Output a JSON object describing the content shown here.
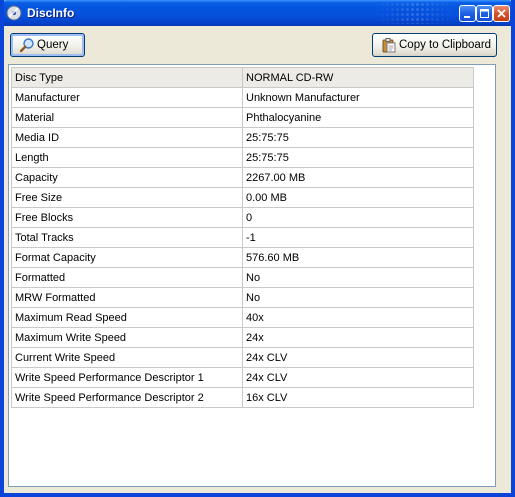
{
  "window": {
    "title": "DiscInfo",
    "accent": "#0b44d8"
  },
  "toolbar": {
    "query_label": "Query",
    "copy_label": "Copy to Clipboard"
  },
  "properties": [
    {
      "name": "Disc Type",
      "value": "NORMAL CD-RW"
    },
    {
      "name": "Manufacturer",
      "value": "Unknown Manufacturer"
    },
    {
      "name": "Material",
      "value": "Phthalocyanine"
    },
    {
      "name": "Media ID",
      "value": "25:75:75"
    },
    {
      "name": "Length",
      "value": "25:75:75"
    },
    {
      "name": "Capacity",
      "value": "2267.00 MB"
    },
    {
      "name": "Free Size",
      "value": "0.00 MB"
    },
    {
      "name": "Free Blocks",
      "value": "0"
    },
    {
      "name": "Total Tracks",
      "value": "-1"
    },
    {
      "name": "Format Capacity",
      "value": "576.60 MB"
    },
    {
      "name": "Formatted",
      "value": "No"
    },
    {
      "name": "MRW Formatted",
      "value": "No"
    },
    {
      "name": "Maximum Read Speed",
      "value": "40x"
    },
    {
      "name": "Maximum Write Speed",
      "value": "24x"
    },
    {
      "name": "Current Write Speed",
      "value": "24x CLV"
    },
    {
      "name": "Write Speed Performance Descriptor 1",
      "value": "24x CLV"
    },
    {
      "name": "Write Speed Performance Descriptor 2",
      "value": "16x CLV"
    }
  ],
  "icons": {
    "app": "disc-icon",
    "query": "magnifier-icon",
    "copy": "clipboard-icon",
    "minimize": "minimize-icon",
    "maximize": "maximize-icon",
    "close": "close-icon"
  }
}
